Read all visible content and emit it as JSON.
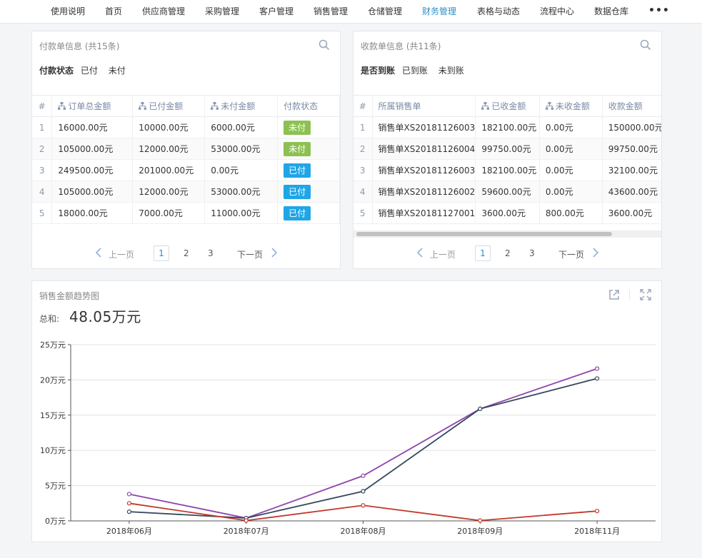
{
  "nav": {
    "items": [
      "使用说明",
      "首页",
      "供应商管理",
      "采购管理",
      "客户管理",
      "销售管理",
      "仓储管理",
      "财务管理",
      "表格与动态",
      "流程中心",
      "数据仓库"
    ],
    "active": "财务管理",
    "more": "•••"
  },
  "payment": {
    "title": "付款单信息 (共15条)",
    "filter_label": "付款状态",
    "filter_options": [
      "已付",
      "未付"
    ],
    "columns": [
      "#",
      "订单总金额",
      "已付金额",
      "未付金额",
      "付款状态"
    ],
    "rows": [
      [
        "1",
        "16000.00元",
        "10000.00元",
        "6000.00元",
        "未付"
      ],
      [
        "2",
        "105000.00元",
        "12000.00元",
        "53000.00元",
        "未付"
      ],
      [
        "3",
        "249500.00元",
        "201000.00元",
        "0.00元",
        "已付"
      ],
      [
        "4",
        "105000.00元",
        "12000.00元",
        "53000.00元",
        "已付"
      ],
      [
        "5",
        "18000.00元",
        "7000.00元",
        "11000.00元",
        "已付"
      ]
    ],
    "pager": {
      "prev": "上一页",
      "pages": [
        "1",
        "2",
        "3"
      ],
      "current": "1",
      "next": "下一页"
    }
  },
  "receipt": {
    "title": "收款单信息 (共11条)",
    "filter_label": "是否到账",
    "filter_options": [
      "已到账",
      "未到账"
    ],
    "columns": [
      "#",
      "所属销售单",
      "已收金额",
      "未收金额",
      "收款金额"
    ],
    "rows": [
      [
        "1",
        "销售单XS20181126003",
        "182100.00元",
        "0.00元",
        "150000.00元"
      ],
      [
        "2",
        "销售单XS20181126004",
        "99750.00元",
        "0.00元",
        "99750.00元"
      ],
      [
        "3",
        "销售单XS20181126003",
        "182100.00元",
        "0.00元",
        "32100.00元"
      ],
      [
        "4",
        "销售单XS20181126002",
        "59600.00元",
        "0.00元",
        "43600.00元"
      ],
      [
        "5",
        "销售单XS20181127001",
        "3600.00元",
        "800.00元",
        "3600.00元"
      ]
    ],
    "pager": {
      "prev": "上一页",
      "pages": [
        "1",
        "2",
        "3"
      ],
      "current": "1",
      "next": "下一页"
    }
  },
  "status_colors": {
    "未付": "#8cc152",
    "已付": "#1ea6e6"
  },
  "chart": {
    "title": "销售金额趋势图",
    "sum_label": "总和:",
    "sum_value": "48.05万元"
  },
  "chart_data": {
    "type": "line",
    "categories": [
      "2018年06月",
      "2018年07月",
      "2018年08月",
      "2018年09月",
      "2018年11月"
    ],
    "y_tick_labels": [
      "0万元",
      "5万元",
      "10万元",
      "15万元",
      "20万元",
      "25万元"
    ],
    "ylim": [
      0,
      25
    ],
    "grid": true,
    "series": [
      {
        "color": "#8e44ad",
        "values": [
          3.8,
          0.4,
          6.4,
          15.9,
          21.6
        ]
      },
      {
        "color": "#34495e",
        "values": [
          1.3,
          0.4,
          4.2,
          15.9,
          20.2
        ]
      },
      {
        "color": "#c0392b",
        "values": [
          2.5,
          0.05,
          2.2,
          0.05,
          1.4
        ]
      }
    ]
  }
}
